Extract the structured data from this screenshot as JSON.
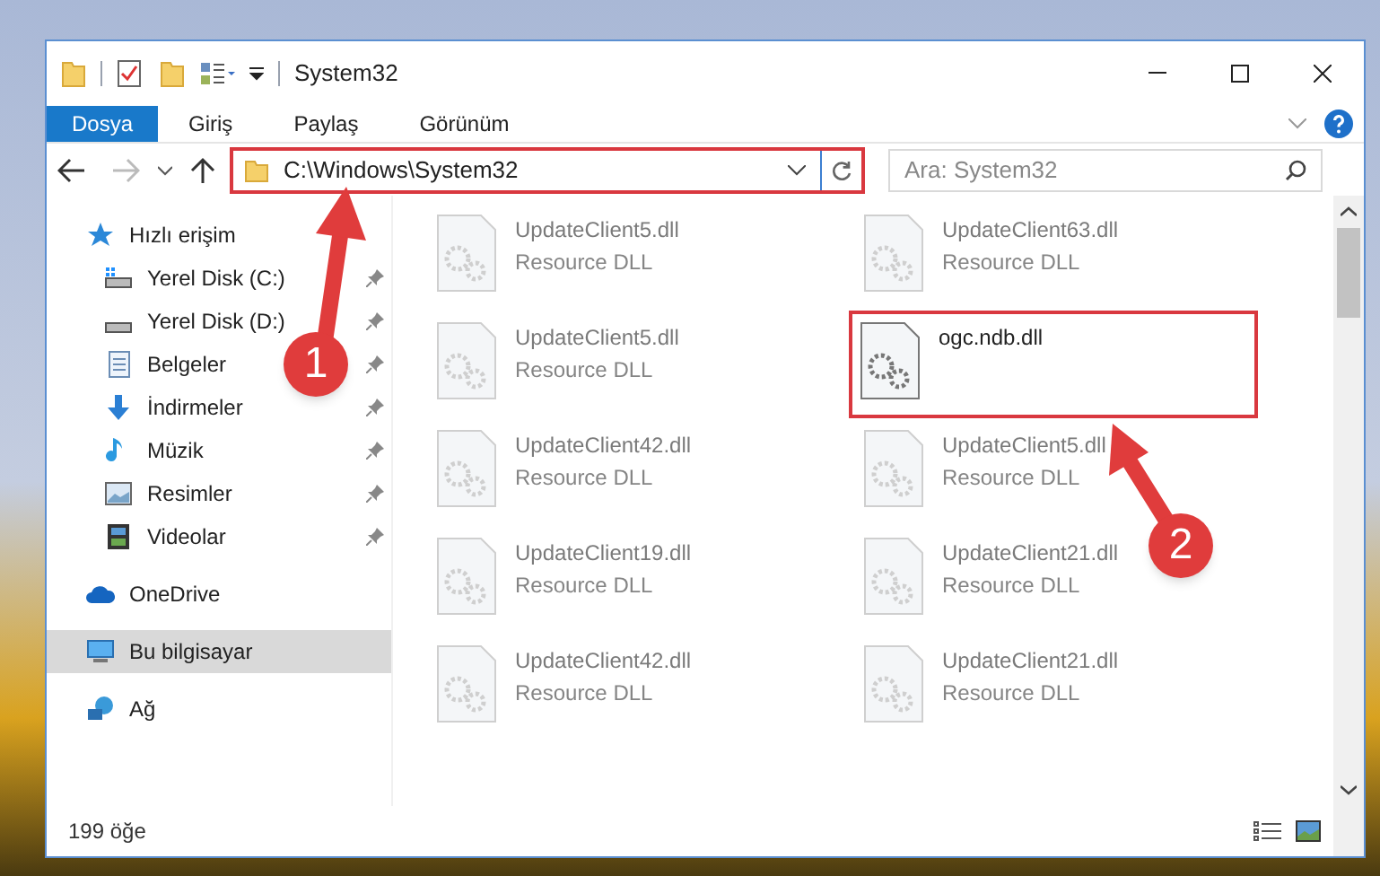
{
  "window": {
    "title": "System32"
  },
  "ribbon_tabs": [
    {
      "label": "Dosya",
      "selected": true
    },
    {
      "label": "Giriş",
      "selected": false
    },
    {
      "label": "Paylaş",
      "selected": false
    },
    {
      "label": "Görünüm",
      "selected": false
    }
  ],
  "address_bar": {
    "path": "C:\\Windows\\System32",
    "outlined": true
  },
  "search": {
    "placeholder": "Ara: System32"
  },
  "nav_pane": [
    {
      "label": "Hızlı erişim",
      "kind": "star",
      "selected": false,
      "children": [
        {
          "label": "Yerel Disk (C:)",
          "kind": "drive-c",
          "pinned": true
        },
        {
          "label": "Yerel Disk (D:)",
          "kind": "drive",
          "pinned": true
        },
        {
          "label": "Belgeler",
          "kind": "docs",
          "pinned": true
        },
        {
          "label": "İndirmeler",
          "kind": "download",
          "pinned": true
        },
        {
          "label": "Müzik",
          "kind": "music",
          "pinned": true
        },
        {
          "label": "Resimler",
          "kind": "pictures",
          "pinned": true
        },
        {
          "label": "Videolar",
          "kind": "video",
          "pinned": true
        }
      ]
    },
    {
      "label": "OneDrive",
      "kind": "cloud",
      "selected": false
    },
    {
      "label": "Bu bilgisayar",
      "kind": "computer",
      "selected": true
    },
    {
      "label": "Ağ",
      "kind": "network",
      "selected": false
    }
  ],
  "files": [
    {
      "name": "UpdateClient5.dll",
      "type": "Resource DLL",
      "dimmed": true,
      "outlined": false
    },
    {
      "name": "UpdateClient63.dll",
      "type": "Resource DLL",
      "dimmed": true,
      "outlined": false
    },
    {
      "name": "UpdateClient5.dll",
      "type": "Resource DLL",
      "dimmed": true,
      "outlined": false
    },
    {
      "name": "ogc.ndb.dll",
      "dimmed": false,
      "outlined": true
    },
    {
      "name": "UpdateClient42.dll",
      "type": "Resource DLL",
      "dimmed": true,
      "outlined": false
    },
    {
      "name": "UpdateClient5.dll",
      "type": "Resource DLL",
      "dimmed": true,
      "outlined": false
    },
    {
      "name": "UpdateClient19.dll",
      "type": "Resource DLL",
      "dimmed": true,
      "outlined": false
    },
    {
      "name": "UpdateClient21.dll",
      "type": "Resource DLL",
      "dimmed": true,
      "outlined": false
    },
    {
      "name": "UpdateClient42.dll",
      "type": "Resource DLL",
      "dimmed": true,
      "outlined": false
    },
    {
      "name": "UpdateClient21.dll",
      "type": "Resource DLL",
      "dimmed": true,
      "outlined": false
    }
  ],
  "status_bar": {
    "item_count": "199 öğe"
  },
  "annotations": [
    {
      "number": "1"
    },
    {
      "number": "2"
    }
  ]
}
